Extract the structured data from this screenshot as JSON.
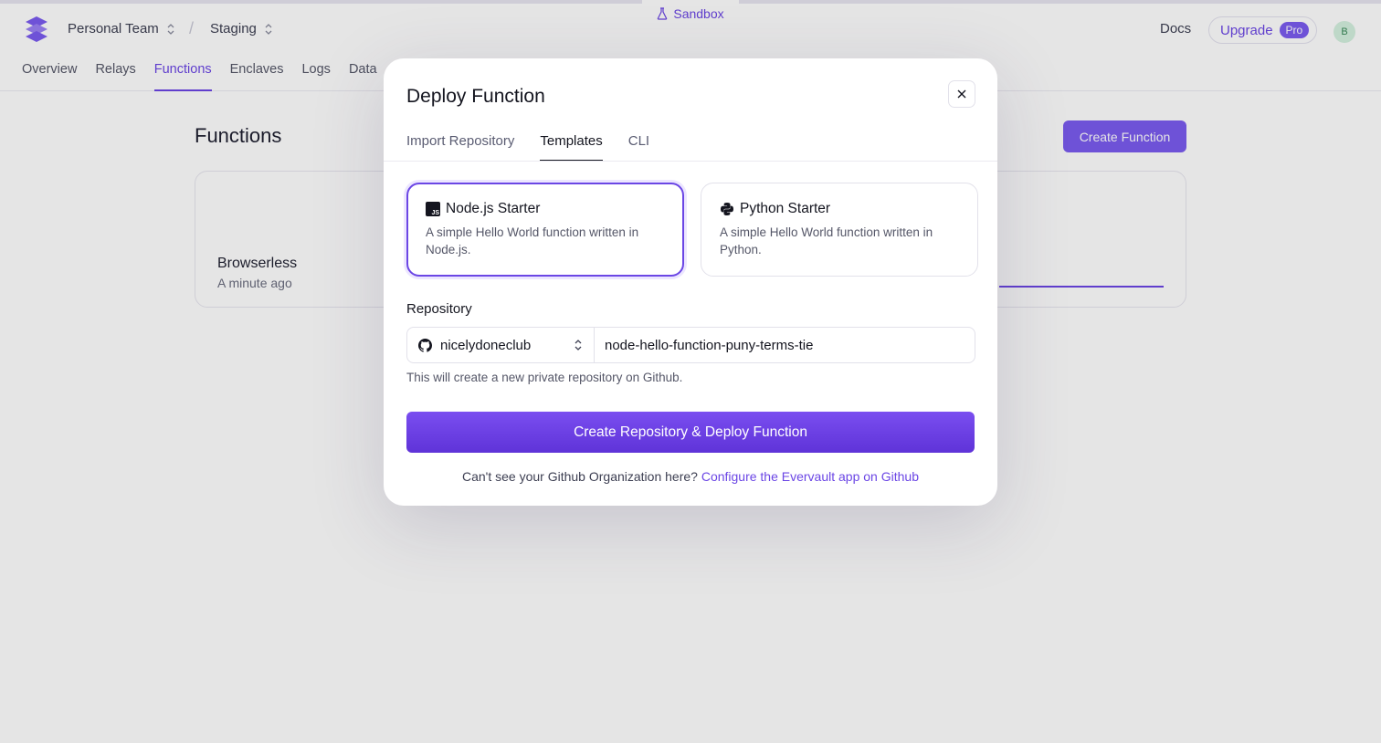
{
  "header": {
    "sandbox_label": "Sandbox",
    "team": "Personal Team",
    "environment": "Staging",
    "docs": "Docs",
    "upgrade": "Upgrade",
    "plan_badge": "Pro",
    "avatar_initial": "B"
  },
  "nav": {
    "items": [
      "Overview",
      "Relays",
      "Functions",
      "Enclaves",
      "Logs",
      "Data"
    ],
    "active": "Functions"
  },
  "page": {
    "title": "Functions",
    "create_button": "Create Function",
    "card": {
      "name": "Browserless",
      "time": "A minute ago"
    }
  },
  "modal": {
    "title": "Deploy Function",
    "tabs": [
      "Import Repository",
      "Templates",
      "CLI"
    ],
    "active_tab": "Templates",
    "templates": [
      {
        "name": "Node.js Starter",
        "description": "A simple Hello World function written in Node.js.",
        "icon": "nodejs-icon",
        "selected": true
      },
      {
        "name": "Python Starter",
        "description": "A simple Hello World function written in Python.",
        "icon": "python-icon",
        "selected": false
      }
    ],
    "repository_label": "Repository",
    "owner": "nicelydoneclub",
    "repo_name": "node-hello-function-puny-terms-tie",
    "hint": "This will create a new private repository on Github.",
    "deploy_button": "Create Repository & Deploy Function",
    "footer_text": "Can't see your Github Organization here?",
    "footer_link": "Configure the Evervault app on Github"
  },
  "colors": {
    "accent": "#6b46e5",
    "button": "#7b5cf0"
  }
}
